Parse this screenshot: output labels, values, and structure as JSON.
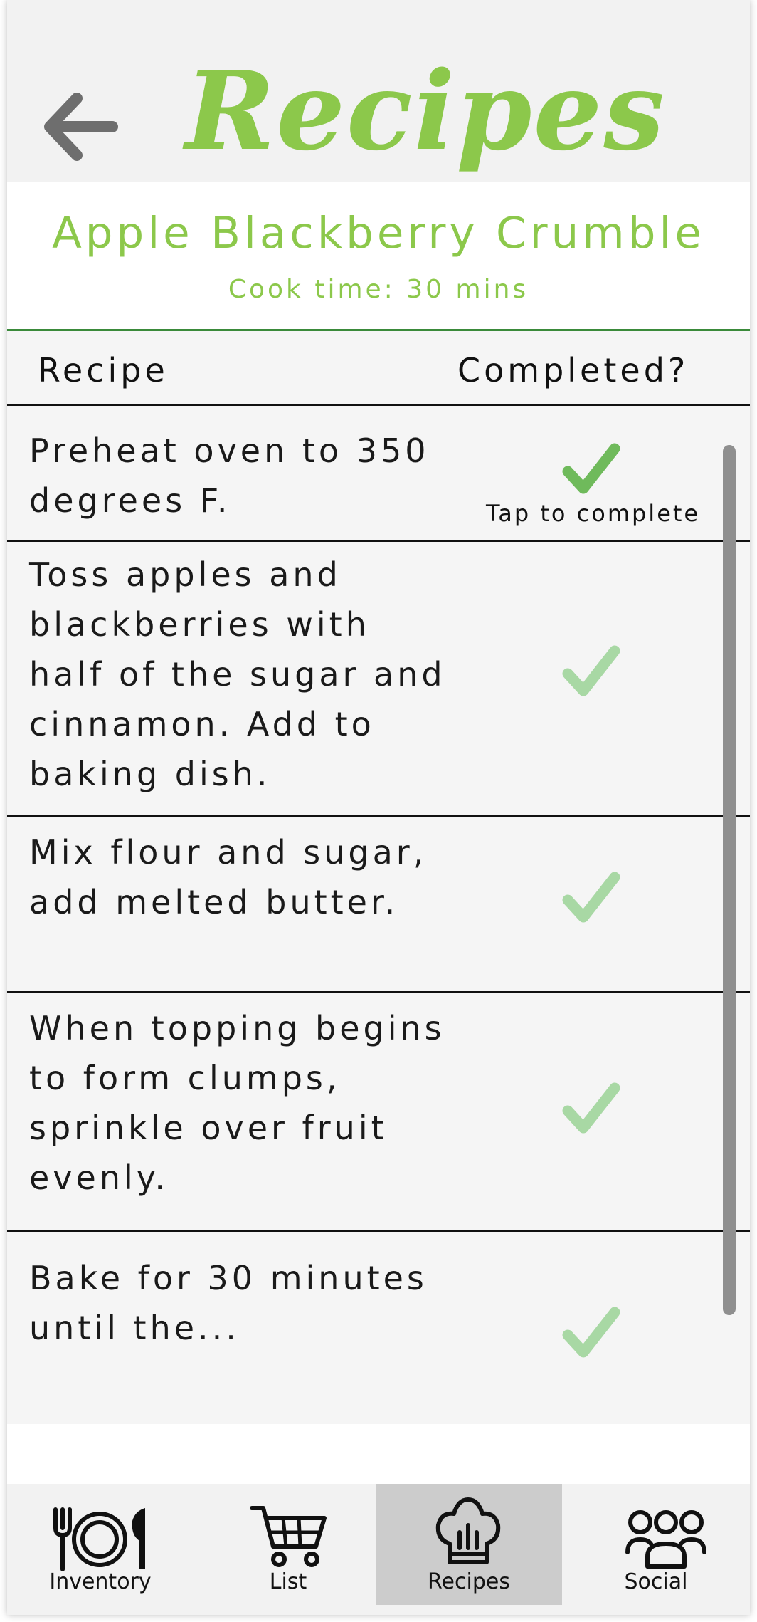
{
  "header": {
    "title": "Recipes",
    "back_icon": "arrow-left-icon"
  },
  "recipe": {
    "name": "Apple Blackberry Crumble",
    "cook_time": "Cook time: 30 mins"
  },
  "table": {
    "col_recipe": "Recipe",
    "col_completed": "Completed?",
    "tap_hint": "Tap to complete",
    "steps": [
      {
        "text": "Preheat oven to 350 degrees F.",
        "completed": true
      },
      {
        "text": "Toss apples and blackberries with half of the sugar and cinnamon. Add to baking dish.",
        "completed": false
      },
      {
        "text": "Mix flour and sugar, add melted butter.",
        "completed": false
      },
      {
        "text": "When topping begins to form clumps, sprinkle over fruit evenly.",
        "completed": false
      },
      {
        "text": "Bake for 30 minutes until the...",
        "completed": false
      }
    ]
  },
  "colors": {
    "accent_green": "#8cc84b",
    "check_done": "#6fba5b",
    "check_pending": "#a8d8a4",
    "divider_green": "#3a8a3a"
  },
  "nav": {
    "active": "Recipes",
    "items": [
      {
        "label": "Inventory",
        "icon": "plate-cutlery-icon"
      },
      {
        "label": "List",
        "icon": "shopping-cart-icon"
      },
      {
        "label": "Recipes",
        "icon": "chef-hat-icon"
      },
      {
        "label": "Social",
        "icon": "group-icon"
      }
    ]
  }
}
